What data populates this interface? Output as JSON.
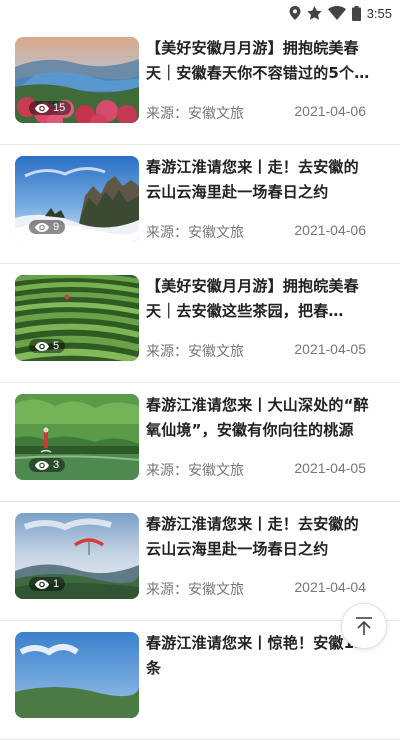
{
  "status_bar": {
    "time": "3:55",
    "icons": [
      "location-icon",
      "star-icon",
      "wifi-icon",
      "battery-icon"
    ]
  },
  "feed": {
    "items": [
      {
        "title": "【美好安徽月月游】拥抱皖美春天｜安徽春天你不容错过的5个摄…",
        "source": "来源：安徽文旅",
        "date": "2021-04-06",
        "views": "15",
        "thumbnail": "lakeside-town-flowers"
      },
      {
        "title": "春游江淮请您来丨走！去安徽的云山云海里赴一场春日之约",
        "source": "来源：安徽文旅",
        "date": "2021-04-06",
        "views": "9",
        "thumbnail": "mountain-sea-of-clouds"
      },
      {
        "title": "【美好安徽月月游】拥抱皖美春天｜去安徽这些茶园，把春天“一…",
        "source": "来源：安徽文旅",
        "date": "2021-04-05",
        "views": "5",
        "thumbnail": "tea-garden-terraces"
      },
      {
        "title": "春游江淮请您来丨大山深处的“醉氧仙境”，安徽有你向往的桃源",
        "source": "来源：安徽文旅",
        "date": "2021-04-05",
        "views": "3",
        "thumbnail": "forest-lake-peach-land"
      },
      {
        "title": "春游江淮请您来丨走！去安徽的云山云海里赴一场春日之约",
        "source": "来源：安徽文旅",
        "date": "2021-04-04",
        "views": "1",
        "thumbnail": "paraglider-over-hills"
      },
      {
        "title": "春游江淮请您来丨惊艳！安徽12条",
        "source": "",
        "date": "",
        "views": "",
        "thumbnail": "blue-sky-landscape"
      }
    ]
  },
  "back_to_top": {
    "icon": "arrow-up-to-top-icon"
  },
  "colors": {
    "title": "#222222",
    "meta": "#777777",
    "divider": "#e8e8e8"
  }
}
